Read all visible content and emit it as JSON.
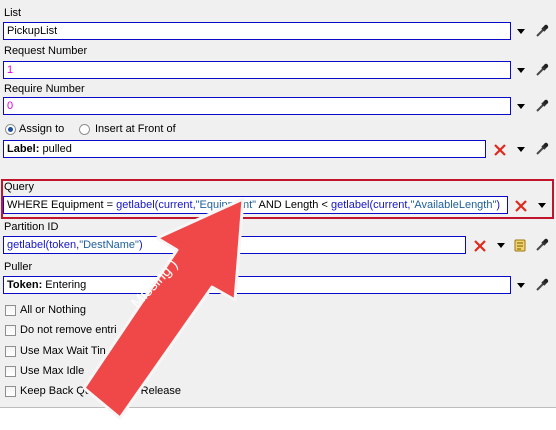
{
  "list": {
    "label": "List",
    "value": "PickupList"
  },
  "request_number": {
    "label": "Request Number",
    "value": "1"
  },
  "require_number": {
    "label": "Require Number",
    "value": "0"
  },
  "assign": {
    "option_assign": "Assign to",
    "option_insert": "Insert at Front of",
    "selected": "Assign to",
    "value_bold": "Label:",
    "value_rest": " pulled"
  },
  "query": {
    "label": "Query",
    "parts": {
      "p1": "WHERE Equipment = ",
      "p2": "getlabel",
      "p3": "(current,",
      "p4": "\"Equipment\"",
      "p5": " AND Length < ",
      "p6": "getlabel",
      "p7": "(current,",
      "p8": "\"AvailableLength\"",
      "p9": ")"
    }
  },
  "partition_id": {
    "label": "Partition ID",
    "parts": {
      "p1": "getlabel",
      "p2": "(token,",
      "p3": "\"DestName\"",
      "p4": ")"
    }
  },
  "puller": {
    "label": "Puller",
    "value_bold": "Token:",
    "value_rest": " Entering"
  },
  "checkboxes": [
    "All or Nothing",
    "Do not remove entri",
    "Use Max Wait Tin",
    "Use Max Idle",
    "Keep Back Queue",
    "rly Release"
  ],
  "annotation": {
    "text": "Missing  )",
    "color": "#f04848"
  },
  "colors": {
    "field_border": "#0a0ac8",
    "highlight_border": "#c0152a",
    "value_magenta": "#e000e0"
  }
}
